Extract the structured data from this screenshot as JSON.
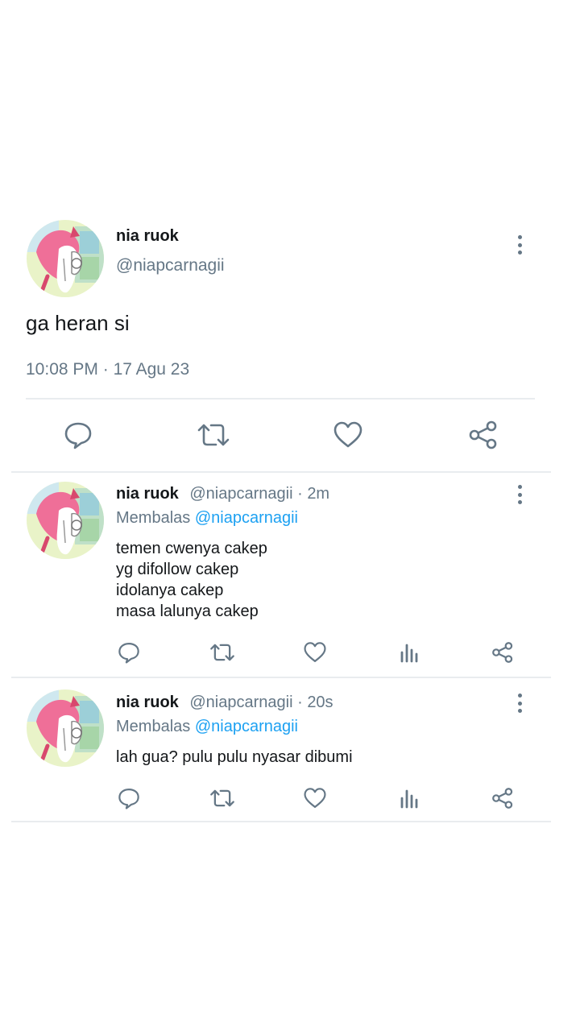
{
  "main_tweet": {
    "name": "nia ruok",
    "handle": "@niapcarnagii",
    "text": "ga heran si",
    "time": "10:08 PM",
    "separator": "·",
    "date": "17 Agu 23",
    "actions": [
      "reply-icon",
      "retweet-icon",
      "like-icon",
      "share-icon"
    ]
  },
  "replies": [
    {
      "name": "nia ruok",
      "handle": "@niapcarnagii",
      "dot": "·",
      "age": "2m",
      "replying_prefix": "Membalas",
      "replying_to": "@niapcarnagii",
      "lines": [
        "temen cwenya cakep",
        "yg difollow cakep",
        "idolanya cakep",
        "masa lalunya cakep"
      ]
    },
    {
      "name": "nia ruok",
      "handle": "@niapcarnagii",
      "dot": "·",
      "age": "20s",
      "replying_prefix": "Membalas",
      "replying_to": "@niapcarnagii",
      "lines": [
        "lah gua? pulu pulu nyasar dibumi"
      ]
    }
  ],
  "colors": {
    "text": "#14171a",
    "muted": "#657786",
    "accent": "#1da1f2",
    "divider": "#e9ecef"
  }
}
